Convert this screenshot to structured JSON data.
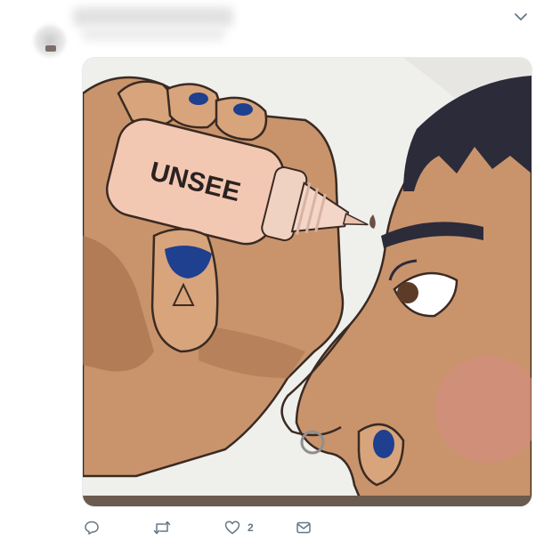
{
  "tweet": {
    "image": {
      "caption_text": "UNSEE",
      "description_icon": "meme-image"
    },
    "actions": {
      "reply_icon": "reply-icon",
      "retweet_icon": "retweet-icon",
      "like_icon": "heart-icon",
      "like_count": "2",
      "message_icon": "envelope-icon"
    },
    "menu_icon": "chevron-down-icon"
  },
  "colors": {
    "icon_gray": "#657786",
    "skin": "#c9946c",
    "skin_shadow": "#a8724e",
    "nail_blue": "#1f3f8f",
    "hair": "#2b2b3a",
    "bottle": "#f3c8b3",
    "background": "#efefec"
  }
}
